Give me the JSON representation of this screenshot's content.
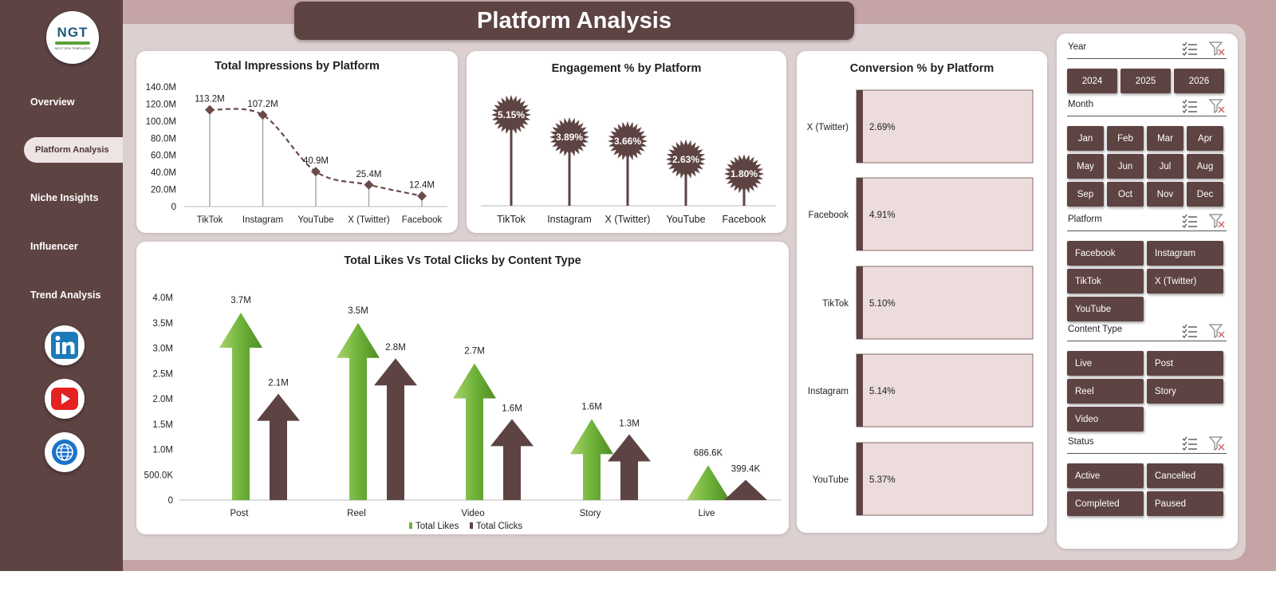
{
  "app": {
    "title": "Platform Analysis",
    "logo": {
      "mark": "NGT",
      "sub": "NEXT GEN TEMPLATES"
    }
  },
  "nav": {
    "items": [
      {
        "label": "Overview",
        "active": false
      },
      {
        "label": "Platform Analysis",
        "active": true
      },
      {
        "label": "Niche Insights",
        "active": false
      },
      {
        "label": "Influencer",
        "active": false
      },
      {
        "label": "Trend Analysis",
        "active": false
      }
    ],
    "social": [
      {
        "name": "linkedin-icon"
      },
      {
        "name": "youtube-icon"
      },
      {
        "name": "globe-icon"
      }
    ]
  },
  "colors": {
    "brand": "#5e4343",
    "accent_green": "#6fb33a",
    "page_bg": "#ddd0d0",
    "line_color": "#6b4a4a",
    "conversion_fill": "#ecdcdc"
  },
  "chart_data": [
    {
      "id": "impressions",
      "type": "line",
      "title": "Total Impressions by Platform",
      "categories": [
        "TikTok",
        "Instagram",
        "YouTube",
        "X (Twitter)",
        "Facebook"
      ],
      "values": [
        113.2,
        107.2,
        40.9,
        25.4,
        12.4
      ],
      "data_labels": [
        "113.2M",
        "107.2M",
        "40.9M",
        "25.4M",
        "12.4M"
      ],
      "ylim": [
        0,
        140
      ],
      "yticks": [
        "0",
        "20.0M",
        "40.0M",
        "60.0M",
        "80.0M",
        "100.0M",
        "120.0M",
        "140.0M"
      ],
      "style": "dashed smoothed line with diamond markers and drop lines"
    },
    {
      "id": "engagement",
      "type": "bar",
      "title": "Engagement  % by Platform",
      "categories": [
        "TikTok",
        "Instagram",
        "X (Twitter)",
        "YouTube",
        "Facebook"
      ],
      "values": [
        5.15,
        3.89,
        3.66,
        2.63,
        1.8
      ],
      "data_labels": [
        "5.15%",
        "3.89%",
        "3.66%",
        "2.63%",
        "1.80%"
      ],
      "ylim": [
        0,
        5.6
      ],
      "style": "lollipop with starburst markers"
    },
    {
      "id": "conversion",
      "type": "bar",
      "title": "Conversion  % by Platform",
      "categories": [
        "X (Twitter)",
        "Facebook",
        "TikTok",
        "Instagram",
        "YouTube"
      ],
      "values": [
        2.69,
        4.91,
        5.1,
        5.14,
        5.37
      ],
      "data_labels": [
        "2.69%",
        "4.91%",
        "5.10%",
        "5.14%",
        "5.37%"
      ],
      "style": "horizontal tiles"
    },
    {
      "id": "likes_clicks",
      "type": "bar",
      "title": "Total Likes Vs Total Clicks by Content Type",
      "categories": [
        "Post",
        "Reel",
        "Video",
        "Story",
        "Live"
      ],
      "series": [
        {
          "name": "Total Likes",
          "values": [
            3.7,
            3.5,
            2.7,
            1.6,
            0.6866
          ],
          "labels": [
            "3.7M",
            "3.5M",
            "2.7M",
            "1.6M",
            "686.6K"
          ],
          "color": "#6fb33a"
        },
        {
          "name": "Total Clicks",
          "values": [
            2.1,
            2.8,
            1.6,
            1.3,
            0.3994
          ],
          "labels": [
            "2.1M",
            "2.8M",
            "1.6M",
            "1.3M",
            "399.4K"
          ],
          "color": "#5e4343"
        }
      ],
      "ylim": [
        0,
        4.0
      ],
      "yticks": [
        "0",
        "500.0K",
        "1.0M",
        "1.5M",
        "2.0M",
        "2.5M",
        "3.0M",
        "3.5M",
        "4.0M"
      ],
      "legend": "bottom",
      "style": "arrow-shaped columns"
    }
  ],
  "slicers": [
    {
      "title": "Year",
      "columns": 3,
      "items": [
        "2024",
        "2025",
        "2026"
      ]
    },
    {
      "title": "Month",
      "columns": 4,
      "items": [
        "Jan",
        "Feb",
        "Mar",
        "Apr",
        "May",
        "Jun",
        "Jul",
        "Aug",
        "Sep",
        "Oct",
        "Nov",
        "Dec"
      ]
    },
    {
      "title": "Platform",
      "columns": 2,
      "items": [
        "Facebook",
        "Instagram",
        "TikTok",
        "X (Twitter)",
        "YouTube"
      ]
    },
    {
      "title": "Content Type",
      "columns": 2,
      "items": [
        "Live",
        "Post",
        "Reel",
        "Story",
        "Video"
      ]
    },
    {
      "title": "Status",
      "columns": 2,
      "items": [
        "Active",
        "Cancelled",
        "Completed",
        "Paused"
      ]
    }
  ]
}
